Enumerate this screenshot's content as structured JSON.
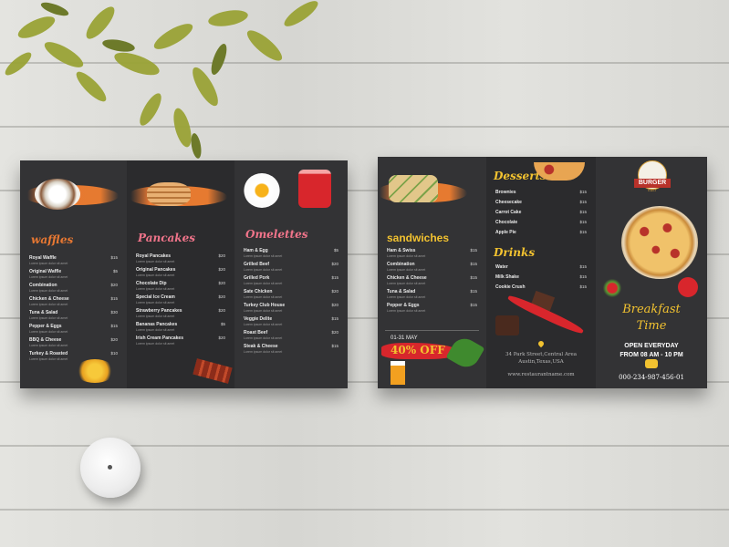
{
  "left": {
    "waffles": {
      "heading": "waffles",
      "items": [
        {
          "name": "Royal Waffle",
          "price": "$15",
          "desc": "Lorem ipsum dolor sit amet"
        },
        {
          "name": "Original Waffle",
          "price": "$5",
          "desc": "Lorem ipsum dolor sit amet"
        },
        {
          "name": "Combination",
          "price": "$20",
          "desc": "Lorem ipsum dolor sit amet"
        },
        {
          "name": "Chicken & Cheese",
          "price": "$15",
          "desc": "Lorem ipsum dolor sit amet"
        },
        {
          "name": "Tuna & Salad",
          "price": "$30",
          "desc": "Lorem ipsum dolor sit amet"
        },
        {
          "name": "Pepper & Eggs",
          "price": "$15",
          "desc": "Lorem ipsum dolor sit amet"
        },
        {
          "name": "BBQ & Cheese",
          "price": "$20",
          "desc": "Lorem ipsum dolor sit amet"
        },
        {
          "name": "Turkey & Roasted",
          "price": "$10",
          "desc": "Lorem ipsum dolor sit amet"
        }
      ]
    },
    "pancakes": {
      "heading": "Pancakes",
      "items": [
        {
          "name": "Royal Pancakes",
          "price": "$20",
          "desc": "Lorem ipsum dolor sit amet"
        },
        {
          "name": "Original Pancakes",
          "price": "$20",
          "desc": "Lorem ipsum dolor sit amet"
        },
        {
          "name": "Chocolate Dip",
          "price": "$20",
          "desc": "Lorem ipsum dolor sit amet"
        },
        {
          "name": "Special Ice Cream",
          "price": "$20",
          "desc": "Lorem ipsum dolor sit amet"
        },
        {
          "name": "Strawberry Pancakes",
          "price": "$20",
          "desc": "Lorem ipsum dolor sit amet"
        },
        {
          "name": "Bananas Pancakes",
          "price": "$5",
          "desc": "Lorem ipsum dolor sit amet"
        },
        {
          "name": "Irish Cream Pancakes",
          "price": "$20",
          "desc": "Lorem ipsum dolor sit amet"
        }
      ]
    },
    "omelettes": {
      "heading": "Omelettes",
      "items": [
        {
          "name": "Ham & Egg",
          "price": "$5",
          "desc": "Lorem ipsum dolor sit amet"
        },
        {
          "name": "Grilled Beef",
          "price": "$20",
          "desc": "Lorem ipsum dolor sit amet"
        },
        {
          "name": "Grilled Pork",
          "price": "$15",
          "desc": "Lorem ipsum dolor sit amet"
        },
        {
          "name": "Sate Chicken",
          "price": "$20",
          "desc": "Lorem ipsum dolor sit amet"
        },
        {
          "name": "Turkey Club House",
          "price": "$20",
          "desc": "Lorem ipsum dolor sit amet"
        },
        {
          "name": "Veggie Delite",
          "price": "$15",
          "desc": "Lorem ipsum dolor sit amet"
        },
        {
          "name": "Roast Beef",
          "price": "$20",
          "desc": "Lorem ipsum dolor sit amet"
        },
        {
          "name": "Steak & Cheese",
          "price": "$15",
          "desc": "Lorem ipsum dolor sit amet"
        }
      ]
    }
  },
  "right": {
    "sandwiches": {
      "heading": "sandwiches",
      "items": [
        {
          "name": "Ham & Swiss",
          "price": "$15",
          "desc": "Lorem ipsum dolor sit amet"
        },
        {
          "name": "Combination",
          "price": "$15",
          "desc": "Lorem ipsum dolor sit amet"
        },
        {
          "name": "Chicken & Cheese",
          "price": "$15",
          "desc": "Lorem ipsum dolor sit amet"
        },
        {
          "name": "Tuna & Salad",
          "price": "$15",
          "desc": "Lorem ipsum dolor sit amet"
        },
        {
          "name": "Pepper & Eggs",
          "price": "$15",
          "desc": "Lorem ipsum dolor sit amet"
        }
      ],
      "promo_date": "01-31 MAY",
      "promo_offer": "40% OFF"
    },
    "desserts": {
      "heading": "Desserts",
      "items": [
        {
          "name": "Brownies",
          "price": "$15"
        },
        {
          "name": "Cheesecake",
          "price": "$15"
        },
        {
          "name": "Carrot Cake",
          "price": "$15"
        },
        {
          "name": "Chocolate",
          "price": "$15"
        },
        {
          "name": "Apple Pie",
          "price": "$15"
        }
      ]
    },
    "drinks": {
      "heading": "Drinks",
      "items": [
        {
          "name": "Water",
          "price": "$15"
        },
        {
          "name": "Milk Shake",
          "price": "$15"
        },
        {
          "name": "Cookie Crush",
          "price": "$15"
        }
      ]
    },
    "address_line1": "34 Park Street,Central Area",
    "address_line2": "Austin,Texas,USA",
    "website": "www.restaurantname.com",
    "cover": {
      "logo_main": "BURGER",
      "logo_sub": "EAST",
      "title_line1": "Breakfast",
      "title_line2": "Time",
      "open_line1": "OPEN EVERYDAY",
      "open_line2": "FROM 08 AM - 10 PM",
      "phone": "000-234-987-456-01"
    }
  },
  "colors": {
    "accent_orange": "#e87832",
    "accent_yellow": "#f2c230",
    "accent_pink": "#f0748a",
    "promo_red": "#d8262c",
    "panel_dark": "#2f2f31"
  }
}
